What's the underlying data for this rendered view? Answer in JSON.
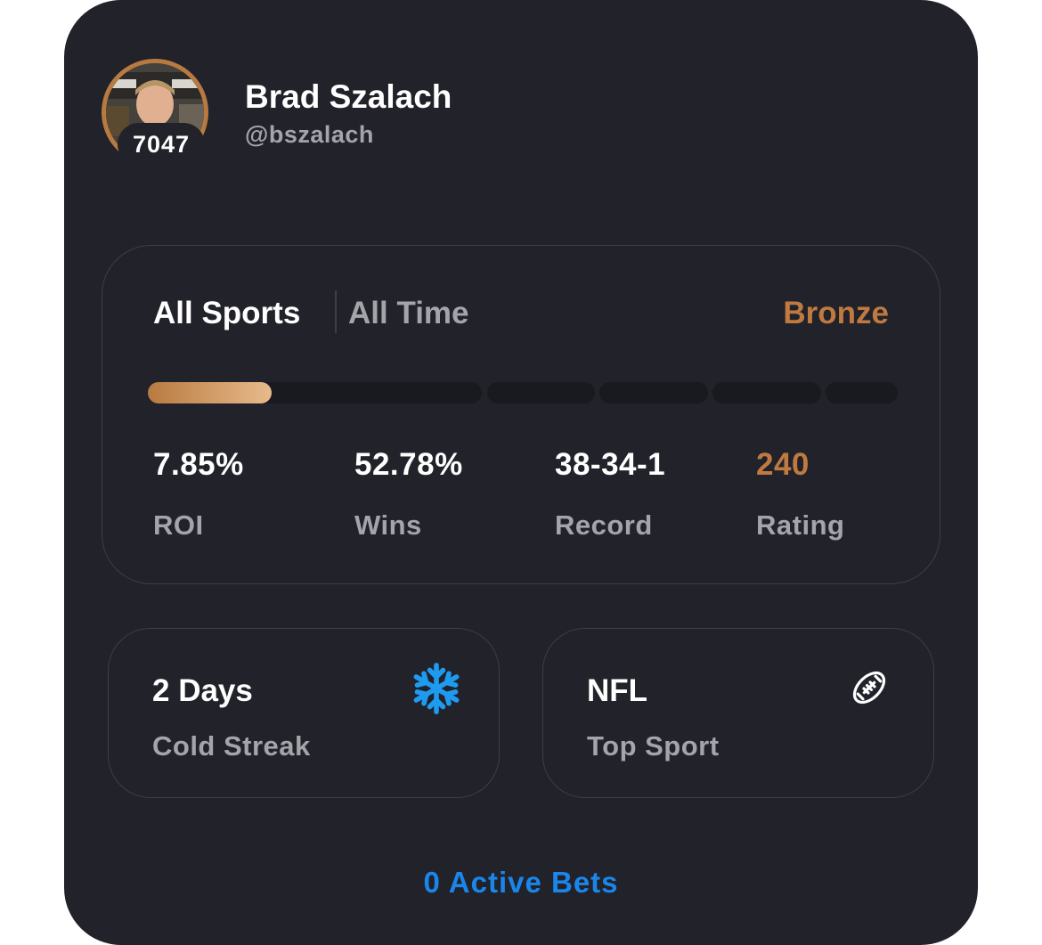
{
  "profile": {
    "name": "Brad Szalach",
    "handle": "@bszalach",
    "rank": "7047"
  },
  "stats_panel": {
    "sport_filter": "All Sports",
    "time_filter": "All Time",
    "tier": "Bronze",
    "tier_color": "#c07a40",
    "tier_progress": 0.165,
    "stats": [
      {
        "value": "7.85%",
        "label": "ROI"
      },
      {
        "value": "52.78%",
        "label": "Wins"
      },
      {
        "value": "38-34-1",
        "label": "Record"
      },
      {
        "value": "240",
        "label": "Rating"
      }
    ]
  },
  "streak_card": {
    "value": "2 Days",
    "label": "Cold Streak",
    "icon": "snowflake-icon",
    "icon_color": "#1e9bf0"
  },
  "top_sport_card": {
    "value": "NFL",
    "label": "Top Sport",
    "icon": "football-icon"
  },
  "active_bets_link": "0 Active Bets",
  "colors": {
    "card_bg": "#21222a",
    "border": "#3d3e46",
    "text_primary": "#ffffff",
    "text_secondary": "#a4a5ab",
    "accent_blue": "#1a86ea"
  }
}
